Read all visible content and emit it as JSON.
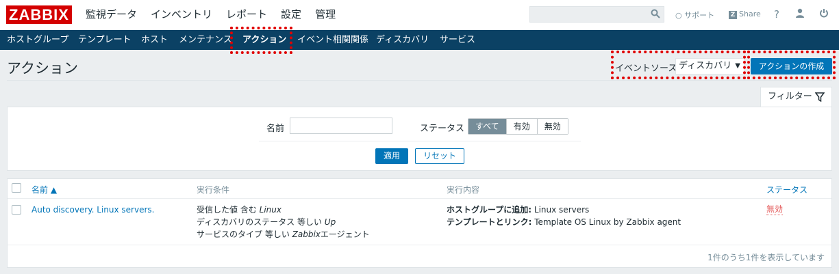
{
  "logo": "ZABBIX",
  "main_menu": [
    "監視データ",
    "インベントリ",
    "レポート",
    "設定",
    "管理"
  ],
  "header": {
    "search_placeholder": "",
    "support_label": "サポート",
    "share_badge": "Z",
    "share_label": "Share",
    "help_icon": "?",
    "user_icon": "user-icon",
    "power_icon": "power-icon"
  },
  "sub_menu": [
    "ホストグループ",
    "テンプレート",
    "ホスト",
    "メンテナンス",
    "アクション",
    "イベント相関関係",
    "ディスカバリ",
    "サービス"
  ],
  "page": {
    "title": "アクション",
    "event_source_label": "イベントソース",
    "event_source_value": "ディスカバリ",
    "create_button": "アクションの作成"
  },
  "filter": {
    "tab_label": "フィルター",
    "name_label": "名前",
    "name_value": "",
    "status_label": "ステータス",
    "status_options": [
      "すべて",
      "有効",
      "無効"
    ],
    "apply_button": "適用",
    "reset_button": "リセット"
  },
  "table": {
    "headers": {
      "name": "名前 ▲",
      "conditions": "実行条件",
      "operations": "実行内容",
      "status": "ステータス"
    },
    "rows": [
      {
        "name": "Auto discovery. Linux servers.",
        "conditions": [
          {
            "text": "受信した値 含む ",
            "italic": "Linux",
            "suffix": ""
          },
          {
            "text": "ディスカバリのステータス 等しい ",
            "italic": "Up",
            "suffix": ""
          },
          {
            "text": "サービスのタイプ 等しい ",
            "italic": "Zabbix",
            "suffix": "エージェント"
          }
        ],
        "operations": [
          {
            "bold": "ホストグループに追加:",
            "text": " Linux servers"
          },
          {
            "bold": "テンプレートとリンク:",
            "text": " Template OS Linux by Zabbix agent"
          }
        ],
        "status": "無効"
      }
    ],
    "footer": "1件のうち1件を表示しています"
  },
  "colors": {
    "brand": "#d40000",
    "nav": "#0b4164",
    "accent": "#0275b8",
    "highlight": "#e00000"
  }
}
